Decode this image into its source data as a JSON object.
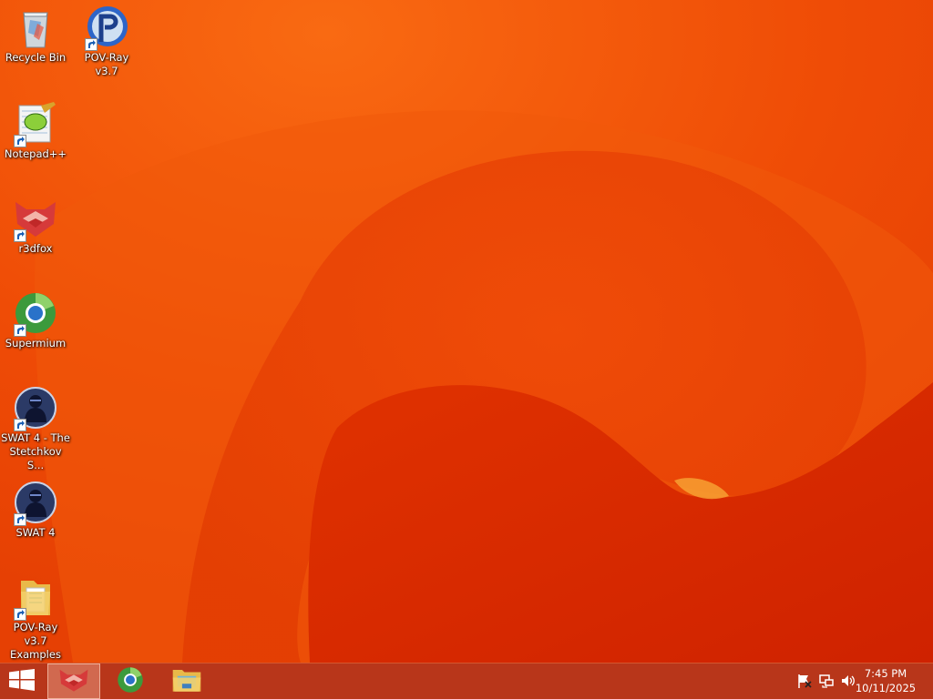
{
  "desktop": {
    "icons": [
      {
        "label": "Recycle Bin",
        "icon": "recycle-bin-icon"
      },
      {
        "label": "POV-Ray v3.7",
        "icon": "povray-icon"
      },
      {
        "label": "Notepad++",
        "icon": "notepadpp-icon"
      },
      {
        "label": "r3dfox",
        "icon": "r3dfox-icon"
      },
      {
        "label": "Supermium",
        "icon": "supermium-icon"
      },
      {
        "label": "SWAT 4 - The Stetchkov S...",
        "icon": "swat4-icon"
      },
      {
        "label": "SWAT 4",
        "icon": "swat4-icon"
      },
      {
        "label": "POV-Ray v3.7 Examples",
        "icon": "folder-icon"
      }
    ]
  },
  "taskbar": {
    "start_icon": "windows-logo-icon",
    "pinned": [
      {
        "name": "r3dfox",
        "icon": "r3dfox-icon",
        "active": true
      },
      {
        "name": "Supermium",
        "icon": "supermium-icon",
        "active": false
      },
      {
        "name": "File Explorer",
        "icon": "file-explorer-icon",
        "active": false
      }
    ],
    "tray": {
      "icons": [
        "action-center-flag-icon",
        "network-icon",
        "volume-icon"
      ],
      "time": "7:45 PM",
      "date": "10/11/2025"
    }
  },
  "colors": {
    "wallpaper_base": "#ec4a06",
    "wallpaper_dark": "#d42a00",
    "taskbar": "#b8361a"
  }
}
